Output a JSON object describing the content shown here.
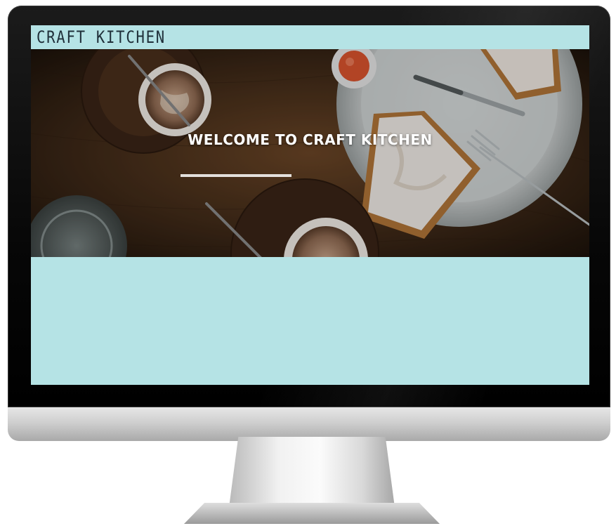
{
  "site": {
    "logo_text": "CRAFT KITCHEN"
  },
  "nav": {
    "items": [
      {
        "label": ""
      },
      {
        "label": ""
      },
      {
        "label": ""
      }
    ]
  },
  "hero": {
    "title": "WELCOME TO CRAFT KITCHEN",
    "subtitle": ""
  },
  "about": {
    "paragraphs": [
      "",
      "",
      ""
    ]
  },
  "colors": {
    "accent": "#b5e3e5",
    "text_on_accent": "#ffffff",
    "logo": "#20303a",
    "monitor_bezel": "#0b0b0b",
    "monitor_chin": "#c9c9c9"
  }
}
